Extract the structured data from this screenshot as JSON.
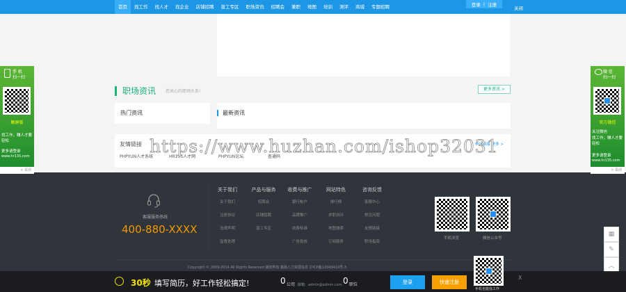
{
  "nav": {
    "items": [
      "首页",
      "找工作",
      "找人才",
      "找企业",
      "店铺招聘",
      "普工专区",
      "职场资讯",
      "招聘会",
      "兼职",
      "地图",
      "培训",
      "测评",
      "商城",
      "专题招聘"
    ],
    "login": "登录",
    "sep": "|",
    "register": "注册",
    "close": "关闭"
  },
  "news": {
    "title": "职场资讯",
    "subtitle": "您关心的职场头条!",
    "more": "更多资讯 >",
    "hot": "热门资讯",
    "latest": "最新资讯"
  },
  "links": {
    "title": "友情链接",
    "apply": "申请链接 更多 >",
    "items": [
      "PHPYUN人才系统",
      "HR135人才网",
      "PHPYUN论坛",
      "查通码"
    ]
  },
  "watermark": "https://www.huzhan.com/ishop32031",
  "footer": {
    "hotline_label": "客服服务热线",
    "phone": "400-880-XXXX",
    "columns": [
      {
        "title": "关于我们",
        "items": [
          "关于我们",
          "注册协议",
          "法律声明",
          "监督处理"
        ]
      },
      {
        "title": "产品与服务",
        "items": [
          "招聘会",
          "店铺招聘",
          "普工专区"
        ]
      },
      {
        "title": "收费与推广",
        "items": [
          "银行帐户",
          "品牌推广",
          "收费标准",
          "广告投放"
        ]
      },
      {
        "title": "网站特色",
        "items": [
          "排行榜",
          "求职测评",
          "地图搜索",
          "订阅服务"
        ]
      },
      {
        "title": "咨询反馈",
        "items": [
          "客服中心",
          "常见问题",
          "友情链接",
          "职场指南"
        ]
      }
    ],
    "qr1": "手机浏览",
    "qr2": "微信公众号",
    "copyright": "Copyright © 2009-2014 All Rights Reserved 版权所有 鑫融人力资源信息 沪ICP备12049410号-3",
    "email": "邮箱：admin@admin.com"
  },
  "bottom": {
    "seconds": "30秒",
    "slogan": "填写简历，好工作轻松搞定!",
    "companies": "0",
    "companies_label": "公司",
    "jobs": "0",
    "jobs_label": "职位",
    "login": "登录",
    "register": "快速注册",
    "qr_label": "手机也能找工作",
    "close": "X"
  },
  "left_float": {
    "head1": "手  机",
    "head2": "扫一扫",
    "tag": "触屏版",
    "text": "找工作，赚人才要轻松",
    "more": "更多请登录",
    "url": "www.hr135.com",
    "close": "× 关闭"
  },
  "right_float": {
    "head1": "微  信",
    "head2": "扫一扫",
    "tag": "官方微信",
    "text0": "关注微信",
    "text": "找工作，赚人才要轻松",
    "more": "更多请登录",
    "url": "www.hr135.com",
    "close": "× 关闭"
  },
  "colors": {
    "nav": "#1e96e6",
    "accent": "#1bb37a",
    "phone": "#f39800",
    "footer": "#30353b"
  }
}
